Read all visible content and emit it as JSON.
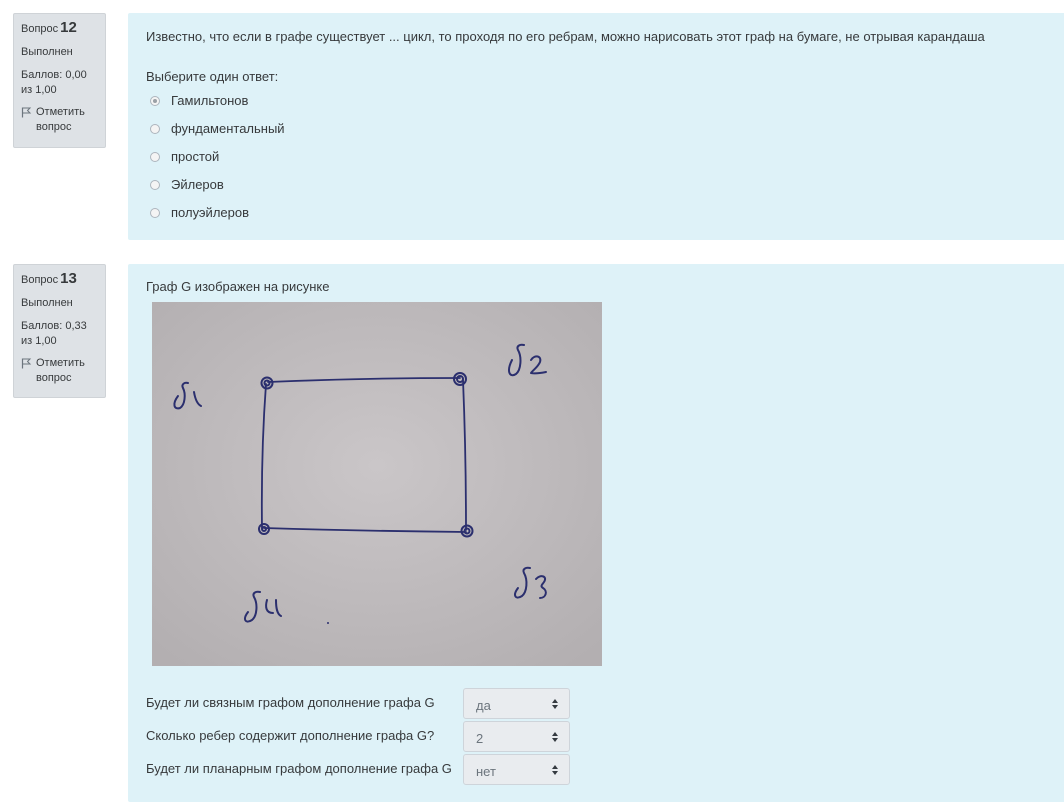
{
  "q12": {
    "label": "Вопрос",
    "number": "12",
    "state": "Выполнен",
    "grade": "Баллов: 0,00 из 1,00",
    "flag_label": "Отметить вопрос",
    "question_text": "Известно, что если в графе существует ... цикл, то проходя по его ребрам, можно нарисовать этот граф на бумаге, не отрывая карандаша",
    "prompt": "Выберите один ответ:",
    "options": [
      {
        "label": "Гамильтонов",
        "checked": true
      },
      {
        "label": "фундаментальный",
        "checked": false
      },
      {
        "label": "простой",
        "checked": false
      },
      {
        "label": "Эйлеров",
        "checked": false
      },
      {
        "label": "полуэйлеров",
        "checked": false
      }
    ]
  },
  "q13": {
    "label": "Вопрос",
    "number": "13",
    "state": "Выполнен",
    "grade": "Баллов: 0,33 из 1,00",
    "flag_label": "Отметить вопрос",
    "question_text": "Граф G изображен на рисунке",
    "image_labels": [
      "v1",
      "v2",
      "v3",
      "v4"
    ],
    "rows": [
      {
        "text": "Будет ли связным графом дополнение графа G",
        "selected": "да"
      },
      {
        "text": "Сколько ребер содержит дополнение графа G?",
        "selected": "2"
      },
      {
        "text": "Будет ли планарным графом дополнение графа G",
        "selected": "нет"
      }
    ]
  }
}
